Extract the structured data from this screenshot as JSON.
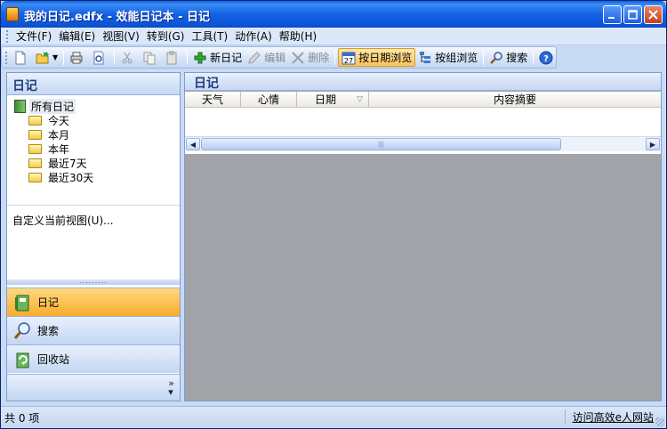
{
  "window": {
    "title": "我的日记.edfx - 效能日记本 - 日记"
  },
  "menu": [
    "文件(F)",
    "编辑(E)",
    "视图(V)",
    "转到(G)",
    "工具(T)",
    "动作(A)",
    "帮助(H)"
  ],
  "toolbar": {
    "new_diary": "新日记",
    "edit": "编辑",
    "delete": "删除",
    "browse_by_date": "按日期浏览",
    "browse_by_group": "按组浏览",
    "search": "搜索"
  },
  "left_panel": {
    "title": "日记",
    "tree": {
      "root": "所有日记",
      "children": [
        "今天",
        "本月",
        "本年",
        "最近7天",
        "最近30天"
      ]
    },
    "customize_link": "自定义当前视图(U)...",
    "nav": [
      "日记",
      "搜索",
      "回收站"
    ]
  },
  "right_panel": {
    "title": "日记",
    "columns": [
      "天气",
      "心情",
      "日期",
      "内容摘要"
    ]
  },
  "status": {
    "count_text": "共 0 项",
    "website_link": "访问高效e人网站"
  },
  "colors": {
    "title_bar": "#1361e6",
    "active_nav": "#f9ac2c",
    "content_bg": "#a1a3a9"
  }
}
